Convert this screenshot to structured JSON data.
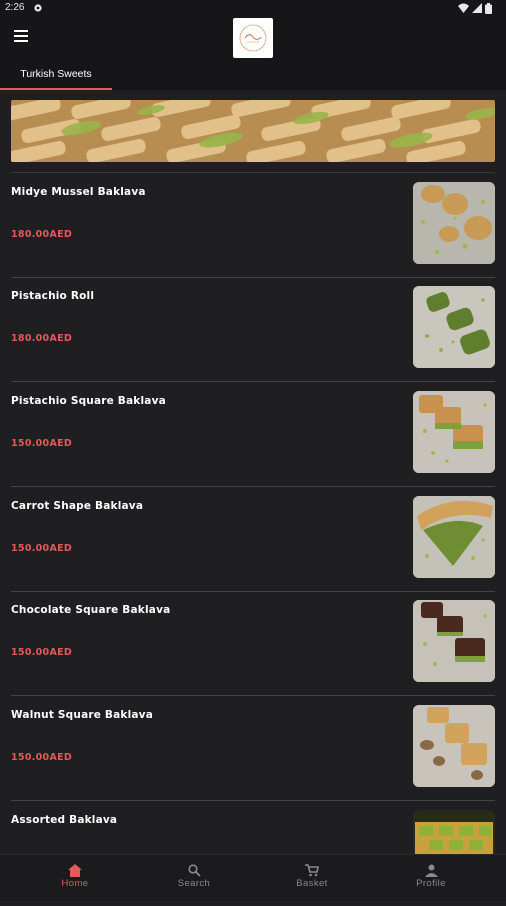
{
  "status_bar": {
    "time": "2:26"
  },
  "tabs": [
    {
      "label": "Turkish Sweets",
      "active": true
    }
  ],
  "products": [
    {
      "name": "Midye Mussel Baklava",
      "price": "180.00AED",
      "image": "mussel-baklava"
    },
    {
      "name": "Pistachio Roll",
      "price": "180.00AED",
      "image": "pistachio-roll"
    },
    {
      "name": "Pistachio Square Baklava",
      "price": "150.00AED",
      "image": "pistachio-square"
    },
    {
      "name": "Carrot Shape Baklava",
      "price": "150.00AED",
      "image": "carrot-shape"
    },
    {
      "name": "Chocolate Square Baklava",
      "price": "150.00AED",
      "image": "chocolate-square"
    },
    {
      "name": "Walnut Square Baklava",
      "price": "150.00AED",
      "image": "walnut-square"
    },
    {
      "name": "Assorted Baklava",
      "price": "",
      "image": "assorted"
    }
  ],
  "bottom_nav": [
    {
      "label": "Home",
      "icon": "home-icon",
      "active": true
    },
    {
      "label": "Search",
      "icon": "search-icon",
      "active": false
    },
    {
      "label": "Basket",
      "icon": "cart-icon",
      "active": false
    },
    {
      "label": "Profile",
      "icon": "person-icon",
      "active": false
    }
  ],
  "colors": {
    "accent": "#e35a5a",
    "background": "#1f1f22",
    "bar": "#161618"
  }
}
